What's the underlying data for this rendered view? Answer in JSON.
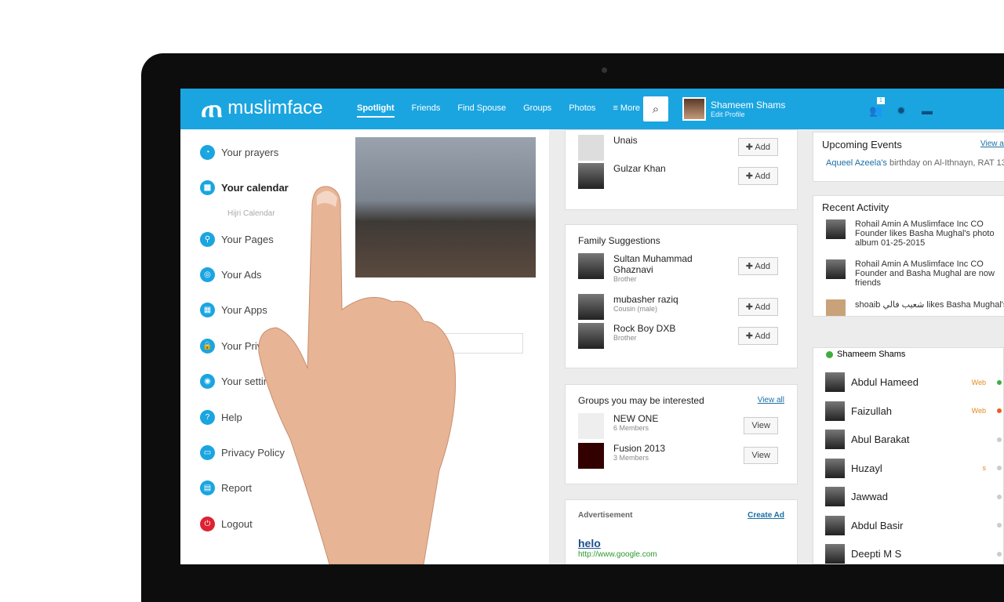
{
  "header": {
    "logo": "muslimface",
    "nav": [
      "Spotlight",
      "Friends",
      "Find Spouse",
      "Groups",
      "Photos",
      "≡ More"
    ],
    "user_name": "Shameem Shams",
    "edit_profile": "Edit Profile",
    "notification_count": "1"
  },
  "menu": [
    "Your prayers",
    "Your calendar",
    "Hijri Calendar",
    "Your Pages",
    "Your Ads",
    "Your Apps",
    "Your Privacy",
    "Your settings",
    "Help",
    "Privacy Policy",
    "Report",
    "Logout"
  ],
  "suggestions": [
    {
      "name": "Unais"
    },
    {
      "name": "Gulzar Khan"
    }
  ],
  "add_label": "Add",
  "family": {
    "title": "Family Suggestions",
    "items": [
      {
        "name": "Sultan Muhammad Ghaznavi",
        "rel": "Brother"
      },
      {
        "name": "mubasher raziq",
        "rel": "Cousin (male)"
      },
      {
        "name": "Rock Boy DXB",
        "rel": "Brother"
      }
    ]
  },
  "groups": {
    "title": "Groups you may be interested",
    "view_all": "View all",
    "view": "View",
    "items": [
      {
        "name": "NEW ONE",
        "members": "6 Members"
      },
      {
        "name": "Fusion 2013",
        "members": "3 Members"
      }
    ]
  },
  "ad": {
    "title": "Advertisement",
    "create": "Create Ad",
    "headline": "helo",
    "url": "http://www.google.com"
  },
  "events": {
    "title": "Upcoming Events",
    "view_all": "View all",
    "name": "Aqueel Azeela's",
    "text": "birthday on Al-Ithnayn, RAT 13"
  },
  "activity": {
    "title": "Recent Activity",
    "items": [
      "Rohail Amin A Muslimface Inc CO Founder likes Basha Mughal's photo album 01-25-2015",
      "Rohail Amin A Muslimface Inc CO Founder and Basha Mughal are now friends",
      "shoaib شعيب فالي likes Basha Mughal's"
    ]
  },
  "chat": {
    "me": "Shameem Shams",
    "friends": [
      {
        "name": "Abdul Hameed",
        "status": "Web",
        "color": "#3fae3f"
      },
      {
        "name": "Faizullah",
        "status": "Web",
        "color": "#e8601c"
      },
      {
        "name": "Abul Barakat",
        "status": "",
        "color": "#ccc"
      },
      {
        "name": "Huzayl",
        "status": "s",
        "color": "#ccc"
      },
      {
        "name": "Jawwad",
        "status": "",
        "color": "#ccc"
      },
      {
        "name": "Abdul Basir",
        "status": "",
        "color": "#ccc"
      },
      {
        "name": "Deepti M S",
        "status": "",
        "color": "#ccc"
      }
    ]
  }
}
